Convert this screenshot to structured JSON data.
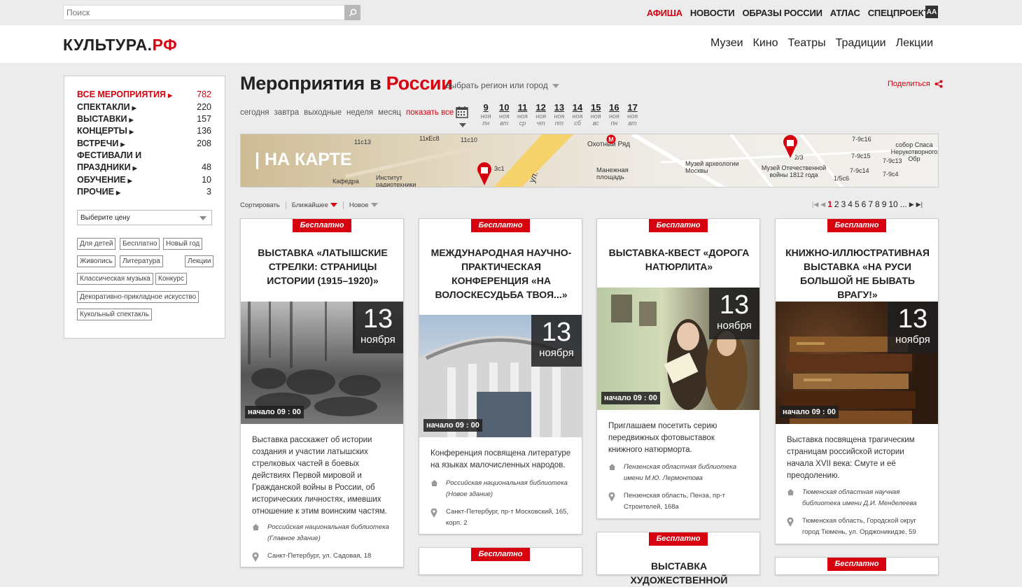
{
  "search": {
    "placeholder": "Поиск"
  },
  "topnav": [
    "АФИША",
    "НОВОСТИ",
    "ОБРАЗЫ РОССИИ",
    "АТЛАС",
    "СПЕЦПРОЕКТЫ"
  ],
  "font_toggle": "AA",
  "logo": {
    "main": "КУЛЬТУРА.",
    "accent": "РФ"
  },
  "mainnav": [
    "Музеи",
    "Кино",
    "Театры",
    "Традиции",
    "Лекции"
  ],
  "sidebar": {
    "categories": [
      {
        "label": "ВСЕ МЕРОПРИЯТИЯ",
        "count": "782"
      },
      {
        "label": "СПЕКТАКЛИ",
        "count": "220"
      },
      {
        "label": "ВЫСТАВКИ",
        "count": "157"
      },
      {
        "label": "КОНЦЕРТЫ",
        "count": "136"
      },
      {
        "label": "ВСТРЕЧИ",
        "count": "208"
      },
      {
        "label": "ФЕСТИВАЛИ И",
        "count": ""
      },
      {
        "label": "ПРАЗДНИКИ",
        "count": "48"
      },
      {
        "label": "ОБУЧЕНИЕ",
        "count": "10"
      },
      {
        "label": "ПРОЧИЕ",
        "count": "3"
      }
    ],
    "price_select": "Выберите цену",
    "tags": [
      "Для детей",
      "Бесплатно",
      "Новый год",
      "Живопись",
      "Литература",
      "Лекции",
      "Классическая музыка",
      "Конкурс",
      "Декоративно-прикладное искусство",
      "Кукольный спектакль"
    ]
  },
  "page": {
    "title_main": "Мероприятия в ",
    "title_accent": "России",
    "region": "выбрать регион или город",
    "share": "Поделиться"
  },
  "periods": [
    "сегодня",
    "завтра",
    "выходные",
    "неделя",
    "месяц",
    "показать все"
  ],
  "days": [
    {
      "num": "9",
      "mon": "ноя",
      "wd": "пн"
    },
    {
      "num": "10",
      "mon": "ноя",
      "wd": "вт"
    },
    {
      "num": "11",
      "mon": "ноя",
      "wd": "ср"
    },
    {
      "num": "12",
      "mon": "ноя",
      "wd": "чт"
    },
    {
      "num": "13",
      "mon": "ноя",
      "wd": "пт"
    },
    {
      "num": "14",
      "mon": "ноя",
      "wd": "сб"
    },
    {
      "num": "15",
      "mon": "ноя",
      "wd": "вс"
    },
    {
      "num": "16",
      "mon": "ноя",
      "wd": "пн"
    },
    {
      "num": "17",
      "mon": "ноя",
      "wd": "вт"
    }
  ],
  "map": {
    "label": "| НА КАРТЕ",
    "labels": [
      "11с13",
      "11кЕс8",
      "11с10",
      "Охотный Ряд",
      "Манежная площадь",
      "Музей археологии Москвы",
      "Институт радиотехники",
      "Кафедра",
      "3с1",
      "ул.",
      "2/3",
      "Музей Отечественной войны 1812 года",
      "1/5с6",
      "7-9с16",
      "собор Спаса Нерукотворного Обр",
      "7-9с15",
      "7-9с13",
      "7-9с14",
      "7-9с4"
    ]
  },
  "sort": {
    "label": "Сортировать",
    "nearest": "Ближайшее",
    "new": "Новое"
  },
  "pager": {
    "pages": [
      "1",
      "2",
      "3",
      "4",
      "5",
      "6",
      "7",
      "8",
      "9",
      "10"
    ],
    "current": "1",
    "ellipsis": "..."
  },
  "cards": [
    {
      "badge": "Бесплатно",
      "title": "ВЫСТАВКА «ЛАТЫШСКИЕ СТРЕЛКИ: СТРАНИЦЫ ИСТОРИИ (1915–1920)»",
      "date_num": "13",
      "date_month": "ноября",
      "start": "начало 09 : 00",
      "desc": "Выставка расскажет об истории создания и участии латышских стрелковых частей в боевых действиях Первой мировой и Гражданской войны в России, об исторических личностях, имевших отношение к этим воинским частям.",
      "place": "Российская национальная библиотека (Главное здание)",
      "address": "Санкт-Петербург, ул. Садовая, 18"
    },
    {
      "badge": "Бесплатно",
      "title": "МЕЖДУНАРОДНАЯ НАУЧНО-ПРАКТИЧЕСКАЯ КОНФЕРЕНЦИЯ «НА ВОЛОСКЕСУДЬБА ТВОЯ...»",
      "date_num": "13",
      "date_month": "ноября",
      "start": "начало 09 : 00",
      "desc": "Конференция посвящена литературе на языках малочисленных народов.",
      "place": "Российская национальная библиотека (Новое здание)",
      "address": "Санкт-Петербург, пр-т Московский, 165, корп. 2"
    },
    {
      "badge": "Бесплатно",
      "title": "ВЫСТАВКА-КВЕСТ «ДОРОГА НАТЮРЛИТА»",
      "date_num": "13",
      "date_month": "ноября",
      "start": "начало 09 : 00",
      "desc": "Приглашаем посетить серию передвижных фотовыставок книжного натюрморта.",
      "place": "Пензенская областная библиотека имени М.Ю. Лермонтова",
      "address": "Пензенская область, Пенза, пр-т Строителей, 168а"
    },
    {
      "badge": "Бесплатно",
      "title": "КНИЖНО-ИЛЛЮСТРАТИВНАЯ ВЫСТАВКА «НА РУСИ БОЛЬШОЙ НЕ БЫВАТЬ ВРАГУ!»",
      "date_num": "13",
      "date_month": "ноября",
      "start": "начало 09 : 00",
      "desc": "Выставка посвящена трагическим страницам российской истории начала XVII века: Смуте и её преодолению.",
      "place": "Тюменская областная научная библиотека имени Д.И. Менделеева",
      "address": "Тюменская область, Городской округ город Тюмень, ул. Орджоникидзе, 59"
    }
  ],
  "next_cards": [
    {
      "badge": "Бесплатно",
      "title": ""
    },
    {
      "badge": "Бесплатно",
      "title": "ВЫСТАВКА ХУДОЖЕСТВЕННОЙ"
    },
    {
      "badge": "Бесплатно",
      "title": ""
    }
  ],
  "colors": {
    "accent": "#d7000f",
    "background": "#ececec"
  }
}
